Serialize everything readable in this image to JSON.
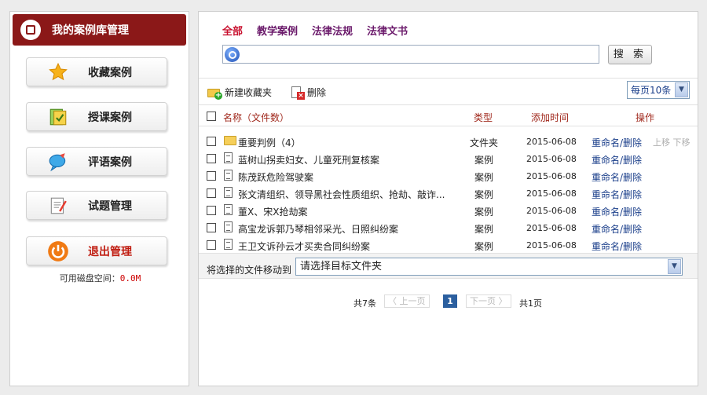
{
  "sidebar": {
    "title": "我的案例库管理",
    "buttons": [
      {
        "label": "收藏案例",
        "icon": "star-icon"
      },
      {
        "label": "授课案例",
        "icon": "book-icon"
      },
      {
        "label": "评语案例",
        "icon": "speech-bubble-icon"
      },
      {
        "label": "试题管理",
        "icon": "exam-paper-icon"
      },
      {
        "label": "退出管理",
        "icon": "power-icon"
      }
    ],
    "disk_label": "可用磁盘空间：",
    "disk_value": "0.0M"
  },
  "main": {
    "tabs": [
      {
        "label": "全部",
        "active": true
      },
      {
        "label": "教学案例",
        "active": false
      },
      {
        "label": "法律法规",
        "active": false
      },
      {
        "label": "法律文书",
        "active": false
      }
    ],
    "search": {
      "value": "",
      "placeholder": "",
      "button": "搜 索"
    },
    "toolbar": {
      "new_folder": "新建收藏夹",
      "delete": "删除",
      "per_page": "每页10条"
    },
    "columns": {
      "name": "名称（文件数）",
      "type": "类型",
      "time": "添加时间",
      "action": "操作"
    },
    "rows": [
      {
        "icon": "folder-icon",
        "name": "重要判例（4）",
        "type": "文件夹",
        "time": "2015-06-08",
        "action": "重命名/删除",
        "move": "上移 下移"
      },
      {
        "icon": "document-icon",
        "name": "蓝树山拐卖妇女、儿童死刑复核案",
        "type": "案例",
        "time": "2015-06-08",
        "action": "重命名/删除",
        "move": ""
      },
      {
        "icon": "document-icon",
        "name": "陈茂跃危险驾驶案",
        "type": "案例",
        "time": "2015-06-08",
        "action": "重命名/删除",
        "move": ""
      },
      {
        "icon": "document-icon",
        "name": "张文清组织、领导黑社会性质组织、抢劫、敲诈...",
        "type": "案例",
        "time": "2015-06-08",
        "action": "重命名/删除",
        "move": ""
      },
      {
        "icon": "document-icon",
        "name": "董X、宋X抢劫案",
        "type": "案例",
        "time": "2015-06-08",
        "action": "重命名/删除",
        "move": ""
      },
      {
        "icon": "document-icon",
        "name": "高宝龙诉郭乃琴相邻采光、日照纠纷案",
        "type": "案例",
        "time": "2015-06-08",
        "action": "重命名/删除",
        "move": ""
      },
      {
        "icon": "document-icon",
        "name": "王卫文诉孙云才买卖合同纠纷案",
        "type": "案例",
        "time": "2015-06-08",
        "action": "重命名/删除",
        "move": ""
      }
    ],
    "move_label": "将选择的文件移动到",
    "move_select": "请选择目标文件夹",
    "pager": {
      "total": "共7条",
      "prev": "〈 上一页",
      "current": "1",
      "next": "下一页 〉",
      "pages": "共1页"
    }
  },
  "colors": {
    "brand": "#8b1818",
    "tab_active": "#c8102e",
    "tab": "#6b1a6b",
    "link": "#1a3e8a",
    "header_text": "#a0281c",
    "pager_current": "#2b5f9f"
  }
}
